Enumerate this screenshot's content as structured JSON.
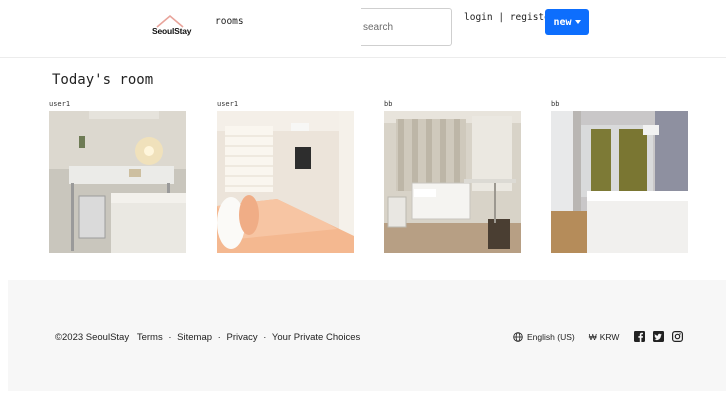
{
  "header": {
    "logo_text": "SeoulStay",
    "nav_rooms": "rooms",
    "search_placeholder": "search",
    "login": "login",
    "auth_separator": "|",
    "register": "register",
    "new_button": "new"
  },
  "main": {
    "section_title": "Today's room",
    "cards": [
      {
        "user": "user1"
      },
      {
        "user": "user1"
      },
      {
        "user": "bb"
      },
      {
        "user": "bb"
      }
    ]
  },
  "footer": {
    "copyright": "©2023 SeoulStay",
    "links": [
      "Terms",
      "Sitemap",
      "Privacy",
      "Your Private Choices"
    ],
    "link_separator": "·",
    "language": "English (US)",
    "currency_symbol": "₩",
    "currency": "KRW",
    "social_icons": [
      "facebook-icon",
      "twitter-icon",
      "instagram-icon"
    ]
  },
  "colors": {
    "accent": "#0d6efd",
    "footer_bg": "#f7f7f7",
    "logo_roof": "#e8a39a"
  }
}
